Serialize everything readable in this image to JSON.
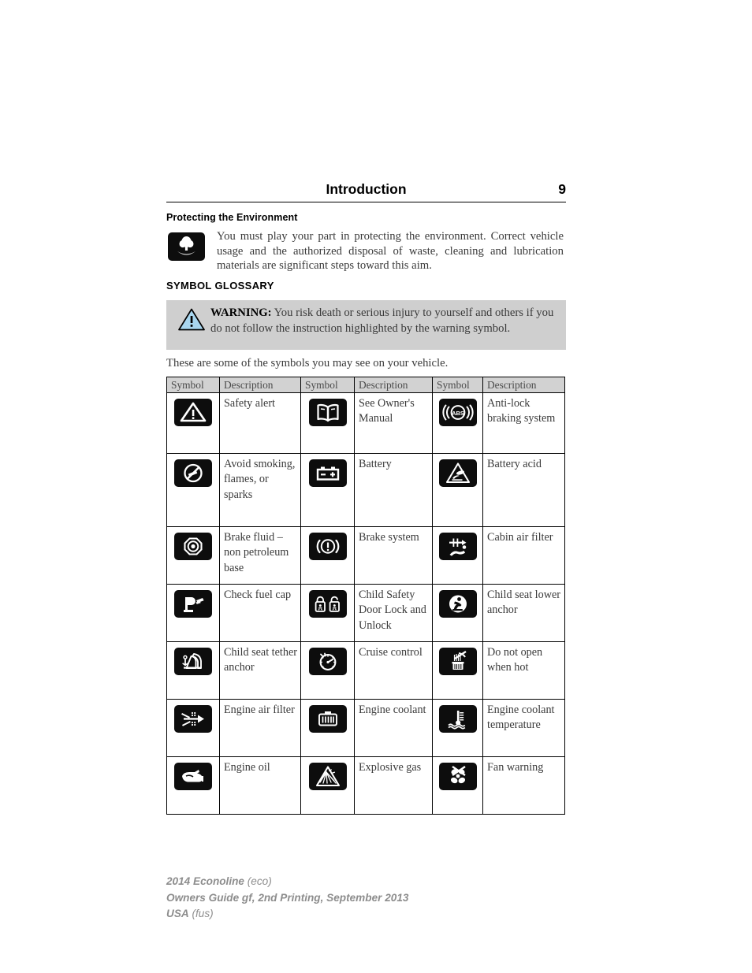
{
  "header": {
    "title": "Introduction",
    "page_number": "9"
  },
  "environment": {
    "heading": "Protecting the Environment",
    "icon": "tree-environment-icon",
    "body": "You must play your part in protecting the environment. Correct vehicle usage and the authorized disposal of waste, cleaning and lubrication materials are significant steps toward this aim."
  },
  "glossary": {
    "heading": "SYMBOL GLOSSARY",
    "warning": {
      "icon": "warning-triangle-icon",
      "label": "WARNING:",
      "text": " You risk death or serious injury to yourself and others if you do not follow the instruction highlighted by the warning symbol."
    },
    "intro": "These are some of the symbols you may see on your vehicle.",
    "columns": [
      "Symbol",
      "Description",
      "Symbol",
      "Description",
      "Symbol",
      "Description"
    ],
    "rows": [
      {
        "cells": [
          {
            "icon": "safety-alert-icon",
            "label": "Safety alert"
          },
          {
            "icon": "see-owners-manual-icon",
            "label": "See Owner's Manual"
          },
          {
            "icon": "anti-lock-braking-system-icon",
            "label": "Anti-lock braking system"
          }
        ]
      },
      {
        "cells": [
          {
            "icon": "avoid-smoking-flames-sparks-icon",
            "label": "Avoid smoking, flames, or sparks"
          },
          {
            "icon": "battery-icon",
            "label": "Battery"
          },
          {
            "icon": "battery-acid-icon",
            "label": "Battery acid"
          }
        ]
      },
      {
        "cells": [
          {
            "icon": "brake-fluid-non-petroleum-icon",
            "label": "Brake fluid – non petroleum base"
          },
          {
            "icon": "brake-system-icon",
            "label": "Brake system"
          },
          {
            "icon": "cabin-air-filter-icon",
            "label": "Cabin air filter"
          }
        ]
      },
      {
        "cells": [
          {
            "icon": "check-fuel-cap-icon",
            "label": "Check fuel cap"
          },
          {
            "icon": "child-safety-door-lock-unlock-icon",
            "label": "Child Safety Door Lock and Unlock"
          },
          {
            "icon": "child-seat-lower-anchor-icon",
            "label": "Child seat lower anchor"
          }
        ]
      },
      {
        "cells": [
          {
            "icon": "child-seat-tether-anchor-icon",
            "label": "Child seat tether anchor"
          },
          {
            "icon": "cruise-control-icon",
            "label": "Cruise control"
          },
          {
            "icon": "do-not-open-when-hot-icon",
            "label": "Do not open when hot"
          }
        ]
      },
      {
        "cells": [
          {
            "icon": "engine-air-filter-icon",
            "label": "Engine air filter"
          },
          {
            "icon": "engine-coolant-icon",
            "label": "Engine coolant"
          },
          {
            "icon": "engine-coolant-temperature-icon",
            "label": "Engine coolant temperature"
          }
        ]
      },
      {
        "cells": [
          {
            "icon": "engine-oil-icon",
            "label": "Engine oil"
          },
          {
            "icon": "explosive-gas-icon",
            "label": "Explosive gas"
          },
          {
            "icon": "fan-warning-icon",
            "label": "Fan warning"
          }
        ]
      }
    ]
  },
  "footer": {
    "line1_bold": "2014 Econoline",
    "line1_paren": "(eco)",
    "line2_bold": "Owners Guide gf, 2nd Printing, September 2013",
    "line3_bold": "USA",
    "line3_paren": "(fus)"
  },
  "colors": {
    "badge_background": "#0d0d0d",
    "warning_box_background": "#cfcfcf",
    "warning_triangle_fill": "#a8d6ef",
    "table_header_background": "#d2d2d2",
    "body_text": "#3a3a3a",
    "footer_text": "#8d8d8d"
  }
}
